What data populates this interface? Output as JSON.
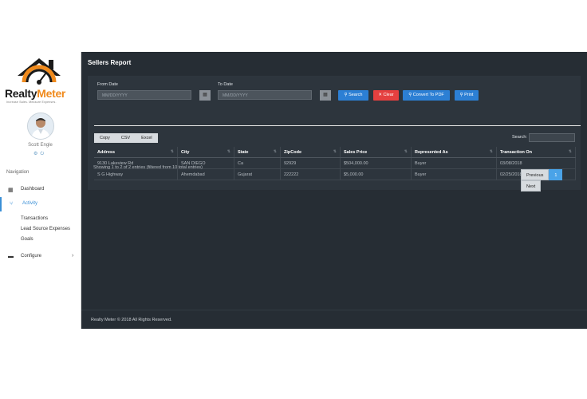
{
  "brand": {
    "name_main": "Realty",
    "name_accent": "Meter",
    "tagline": "Increase Sales. Measure Expenses."
  },
  "user": {
    "name": "Scott Engle"
  },
  "nav": {
    "heading": "Navigation",
    "dashboard": "Dashboard",
    "activity": "Activity",
    "sub_items": [
      "Transactions",
      "Lead Source Expenses",
      "Goals"
    ],
    "configure": "Configure"
  },
  "page": {
    "title": "Sellers Report"
  },
  "filters": {
    "from_label": "From Date",
    "to_label": "To Date",
    "from_placeholder": "MM/DD/YYYY",
    "to_placeholder": "MM/DD/YYYY",
    "search_btn": "Search",
    "clear_btn": "Clear",
    "pdf_btn": "Convert To PDF",
    "print_btn": "Print"
  },
  "export": [
    "Copy",
    "CSV",
    "Excel"
  ],
  "search_label": "Search:",
  "table": {
    "columns": [
      "Address",
      "City",
      "State",
      "ZipCode",
      "Sales Price",
      "Represented As",
      "Transaction On"
    ],
    "rows": [
      [
        "9130 Lakeview Rd",
        "SAN DIEGO",
        "Ca",
        "92929",
        "$504,000.00",
        "Buyer",
        "03/08/2018"
      ],
      [
        "S G Highway",
        "Ahemdabad",
        "Gujarat",
        "222222",
        "$5,000.00",
        "Buyer",
        "02/25/2018"
      ]
    ]
  },
  "info": "Showing 1 to 2 of 2 entries (filtered from 10 total entries)",
  "pagination": {
    "previous": "Previous",
    "current": "1",
    "next": "Next"
  },
  "footer": "Realty Meter © 2018 All Rights Reserved.",
  "colors": {
    "accent": "#f08a1c",
    "primary": "#2c7fd4",
    "danger": "#e5403f",
    "background": "#262d34"
  }
}
